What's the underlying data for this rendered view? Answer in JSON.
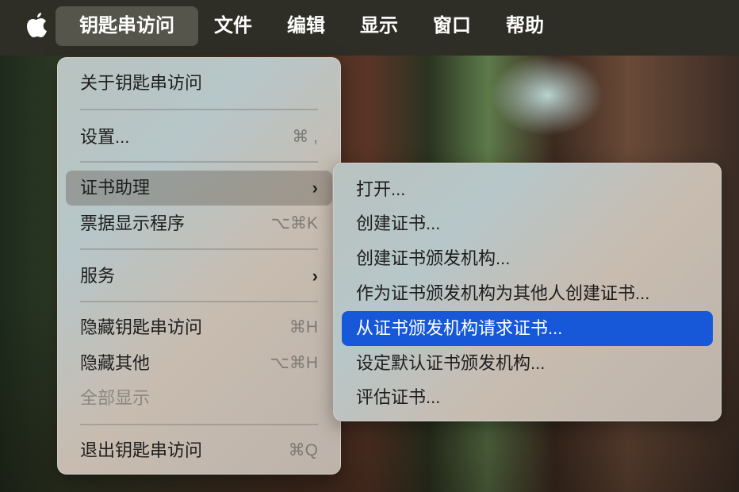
{
  "menubar": {
    "items": [
      "钥匙串访问",
      "文件",
      "编辑",
      "显示",
      "窗口",
      "帮助"
    ]
  },
  "app_menu": {
    "about": "关于钥匙串访问",
    "settings": {
      "label": "设置...",
      "shortcut": "⌘ ,"
    },
    "cert_assistant": {
      "label": "证书助理"
    },
    "ticket_viewer": {
      "label": "票据显示程序",
      "shortcut": "⌥⌘K"
    },
    "services": {
      "label": "服务"
    },
    "hide": {
      "label": "隐藏钥匙串访问",
      "shortcut": "⌘H"
    },
    "hide_others": {
      "label": "隐藏其他",
      "shortcut": "⌥⌘H"
    },
    "show_all": {
      "label": "全部显示"
    },
    "quit": {
      "label": "退出钥匙串访问",
      "shortcut": "⌘Q"
    }
  },
  "submenu": {
    "items": [
      "打开...",
      "创建证书...",
      "创建证书颁发机构...",
      "作为证书颁发机构为其他人创建证书...",
      "从证书颁发机构请求证书...",
      "设定默认证书颁发机构...",
      "评估证书..."
    ]
  }
}
